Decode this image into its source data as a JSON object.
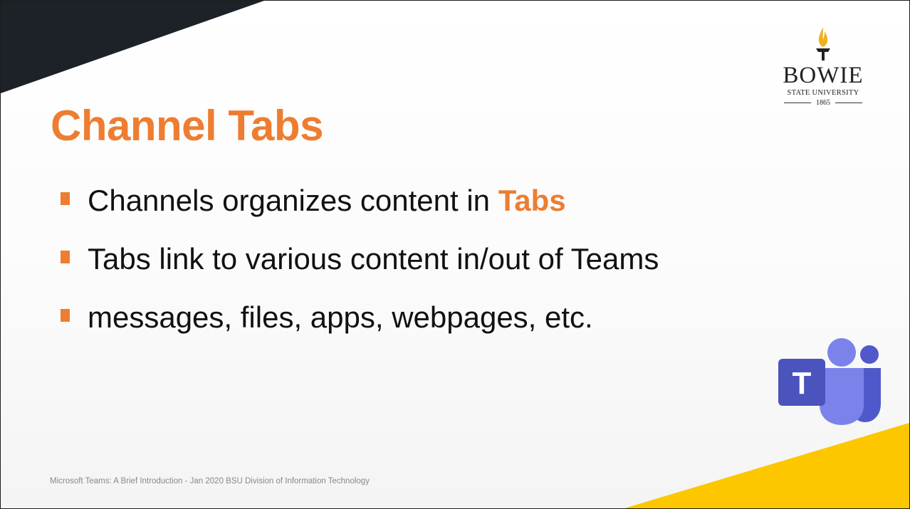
{
  "slide": {
    "title": "Channel Tabs",
    "bullets": [
      {
        "text": "Channels organizes content in ",
        "emphasis": "Tabs"
      },
      {
        "text": "Tabs link to various content in/out of Teams"
      },
      {
        "text": "messages, files, apps, webpages, etc."
      }
    ],
    "footer": "Microsoft Teams: A Brief Introduction  - Jan 2020 BSU Division of Information Technology"
  },
  "university_logo": {
    "wordmark": "BOWIE",
    "subtitle": "STATE UNIVERSITY",
    "year": "1865"
  },
  "teams_logo": {
    "letter": "T"
  },
  "colors": {
    "accent_orange": "#ee7d31",
    "corner_dark": "#1d2228",
    "corner_gold": "#fdc700",
    "torch_gold": "#f2b01b",
    "teams_purple": "#5059c9",
    "teams_purple_light": "#7b83eb",
    "teams_purple_dark": "#4b53bc",
    "text": "#111111"
  }
}
